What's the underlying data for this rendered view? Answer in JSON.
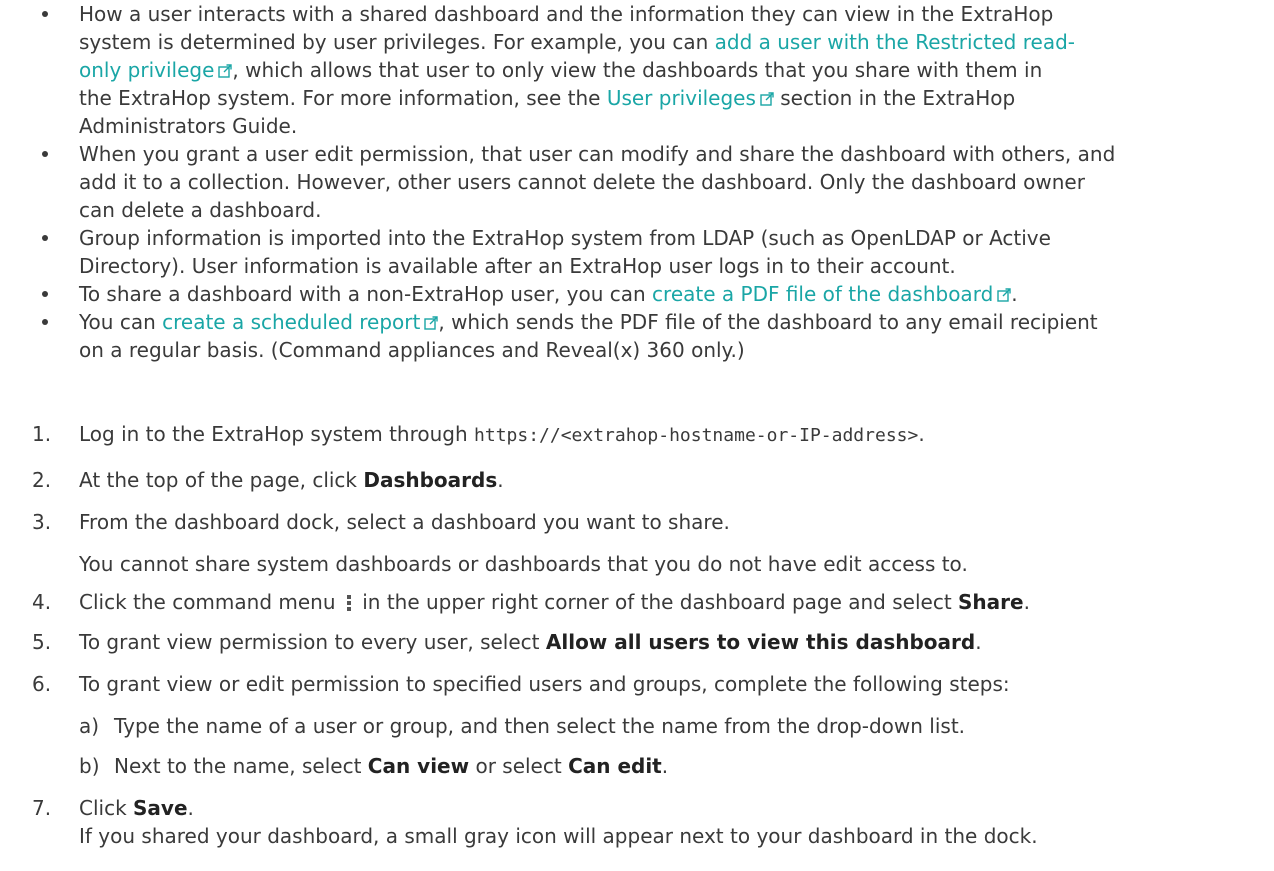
{
  "bullets": [
    {
      "lines": [
        [
          "How a user interacts with a shared dashboard and the information they can view in the ExtraHop"
        ],
        [
          "system is determined by user privileges. For example, you can ",
          {
            "link": "add a user with the Restricted read-"
          }
        ],
        [
          {
            "link": "only privilege",
            "icon": true
          },
          ", which allows that user to only view the dashboards that you share with them in"
        ],
        [
          "the ExtraHop system. For more information, see the ",
          {
            "link": "User privileges",
            "icon": true
          },
          " section in the ExtraHop"
        ],
        [
          "Administrators Guide."
        ]
      ]
    },
    {
      "lines": [
        [
          "When you grant a user edit permission, that user can modify and share the dashboard with others, and"
        ],
        [
          "add it to a collection. However, other users cannot delete the dashboard. Only the dashboard owner"
        ],
        [
          "can delete a dashboard."
        ]
      ]
    },
    {
      "lines": [
        [
          "Group information is imported into the ExtraHop system from LDAP (such as OpenLDAP or Active"
        ],
        [
          "Directory). User information is available after an ExtraHop user logs in to their account."
        ]
      ]
    },
    {
      "lines": [
        [
          "To share a dashboard with a non-ExtraHop user, you can ",
          {
            "link": "create a PDF file of the dashboard",
            "icon": true
          },
          "."
        ]
      ]
    },
    {
      "lines": [
        [
          "You can ",
          {
            "link": "create a scheduled report",
            "icon": true
          },
          ", which sends the PDF file of the dashboard to any email recipient"
        ],
        [
          "on a regular basis. (Command appliances and Reveal(x) 360 only.)"
        ]
      ]
    }
  ],
  "steps": [
    {
      "num": "1.",
      "lines": [
        [
          "Log in to the ExtraHop system through ",
          {
            "code": "https://<extrahop-hostname-or-IP-address>"
          },
          "."
        ]
      ]
    },
    {
      "num": "2.",
      "lines": [
        [
          "At the top of the page, click ",
          {
            "bold": "Dashboards"
          },
          "."
        ]
      ]
    },
    {
      "num": "3.",
      "lines": [
        [
          "From the dashboard dock, select a dashboard you want to share."
        ]
      ]
    },
    {
      "num": "",
      "lines": [
        [
          "You cannot share system dashboards or dashboards that you do not have edit access to."
        ]
      ]
    },
    {
      "num": "4.",
      "lines": [
        [
          "Click the command menu ",
          {
            "kebab": true
          },
          " in the upper right corner of the dashboard page and select ",
          {
            "bold": "Share"
          },
          "."
        ]
      ]
    },
    {
      "num": "5.",
      "lines": [
        [
          "To grant view permission to every user, select ",
          {
            "bold": "Allow all users to view this dashboard"
          },
          "."
        ]
      ]
    },
    {
      "num": "6.",
      "lines": [
        [
          "To grant view or edit permission to specified users and groups, complete the following steps:"
        ]
      ]
    },
    {
      "num": "a)",
      "sub": true,
      "lines": [
        [
          "Type the name of a user or group, and then select the name from the drop-down list."
        ]
      ]
    },
    {
      "num": "b)",
      "sub": true,
      "lines": [
        [
          "Next to the name, select ",
          {
            "bold": "Can view"
          },
          " or select ",
          {
            "bold": "Can edit"
          },
          "."
        ]
      ]
    },
    {
      "num": "7.",
      "lines": [
        [
          "Click ",
          {
            "bold": "Save"
          },
          "."
        ],
        [
          "If you shared your dashboard, a small gray icon will appear next to your dashboard in the dock."
        ]
      ]
    }
  ],
  "colors": {
    "link": "#1aa6a6",
    "text": "#3a3a3a"
  }
}
